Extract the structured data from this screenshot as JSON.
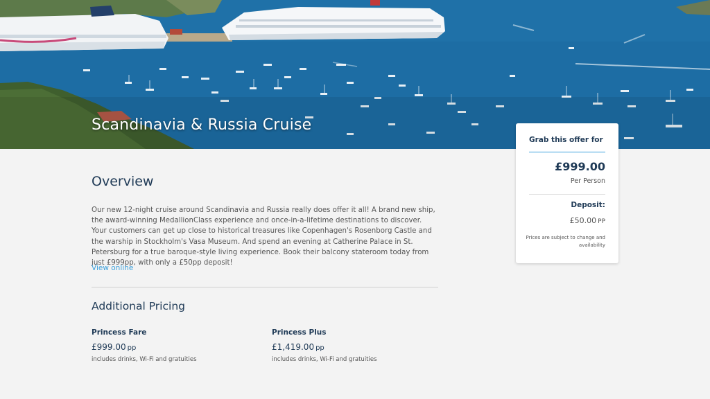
{
  "hero": {
    "title": "Scandinavia & Russia Cruise"
  },
  "overview": {
    "heading": "Overview",
    "body": "Our new 12-night cruise around Scandinavia and Russia really does offer it all! A brand new ship, the award-winning MedallionClass experience and once-in-a-lifetime destinations to discover. Your customers can get up close to historical treasures like Copenhagen's Rosenborg Castle and the warship in Stockholm's Vasa Museum. And spend an evening at Catherine Palace in St. Petersburg for a true baroque-style living experience. Book their balcony stateroom today from just £999pp, with only a £50pp deposit!",
    "link_label": "View online"
  },
  "additional_pricing": {
    "heading": "Additional Pricing",
    "fares": [
      {
        "name": "Princess Fare",
        "price": "£999.00",
        "unit": "pp",
        "note": "includes drinks, Wi-Fi and gratuities"
      },
      {
        "name": "Princess Plus",
        "price": "£1,419.00",
        "unit": "pp",
        "note": "includes drinks, Wi-Fi and gratuities"
      }
    ]
  },
  "offer": {
    "title": "Grab this offer for",
    "price": "£999.00",
    "per_label": "Per Person",
    "deposit_label": "Deposit:",
    "deposit_value": "£50.00",
    "deposit_unit": "PP",
    "disclaimer": "Prices are subject to change and availability"
  },
  "colors": {
    "accent": "#3aa0dc",
    "heading": "#1f3a56",
    "background": "#f3f3f3"
  }
}
